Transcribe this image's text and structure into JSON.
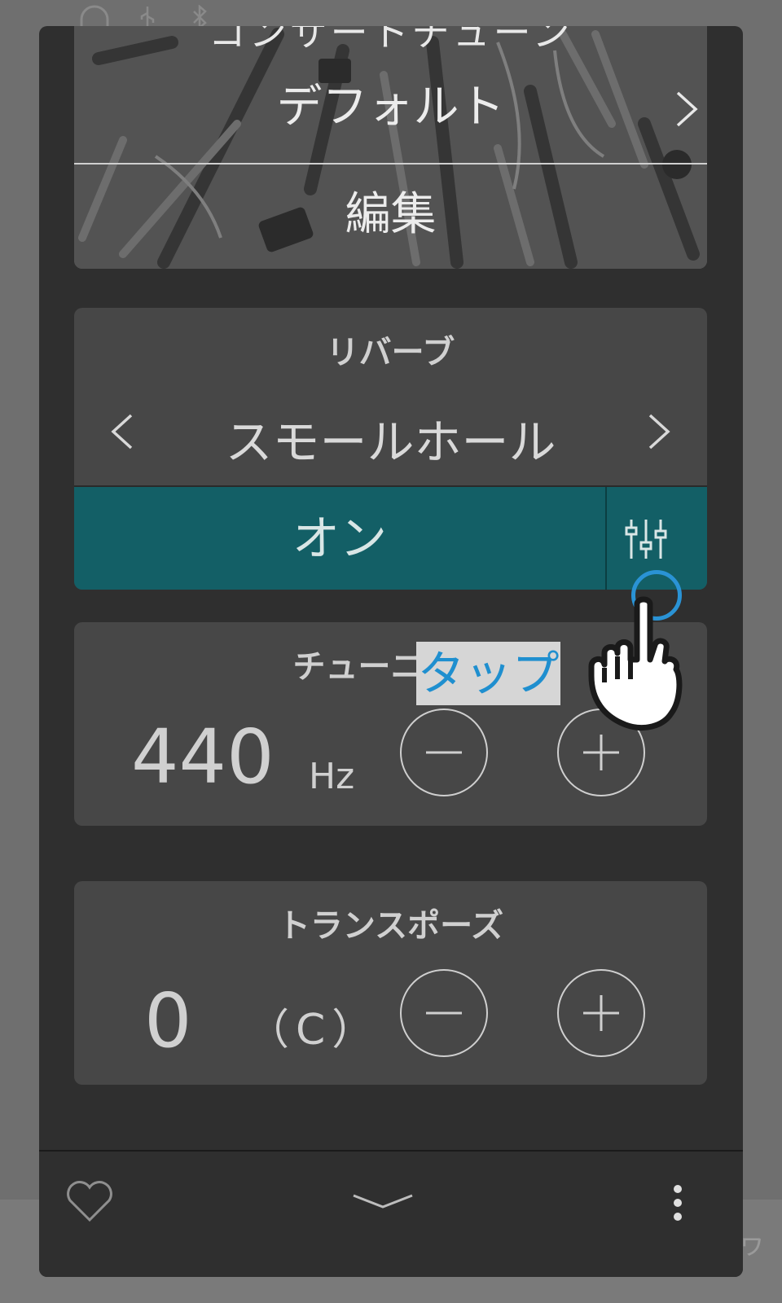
{
  "status_bar": {
    "icons": [
      "headphones-icon",
      "usb-icon",
      "bluetooth-icon"
    ]
  },
  "image_card": {
    "partial_title": "コンサートチューン",
    "default_label": "デフォルト",
    "edit_label": "編集"
  },
  "reverb": {
    "title": "リバーブ",
    "type": "スモールホール",
    "toggle_label": "オン"
  },
  "tuning": {
    "title": "チューニング",
    "value": "440",
    "unit": "Hz"
  },
  "transpose": {
    "title": "トランスポーズ",
    "value": "0",
    "note": "（C）"
  },
  "annotation": {
    "tap_label": "タップ"
  },
  "colors": {
    "panel": "#2f2f2f",
    "card": "#474747",
    "on_bar": "#135f66",
    "tap_ring": "#2a93d5",
    "tap_text": "#1f8fcf"
  },
  "bottom_bar": {
    "icons": [
      "heart-icon",
      "chevron-down-icon",
      "more-vertical-icon"
    ]
  }
}
